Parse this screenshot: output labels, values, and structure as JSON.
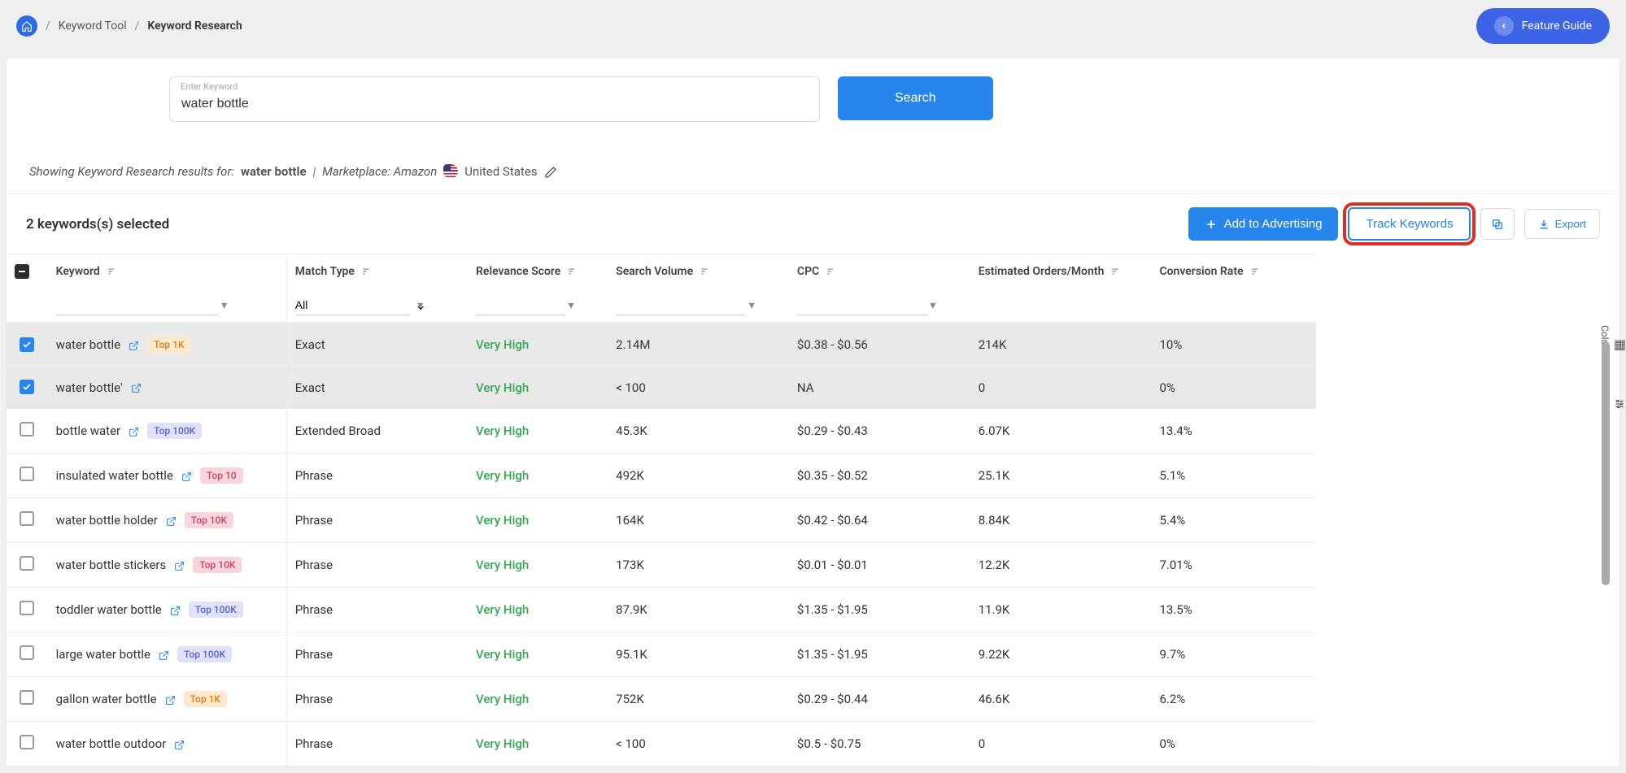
{
  "breadcrumb": {
    "root": "Keyword Tool",
    "current": "Keyword Research"
  },
  "feature_guide": "Feature Guide",
  "search": {
    "label": "Enter Keyword",
    "value": "water bottle",
    "button": "Search"
  },
  "results_info": {
    "prefix": "Showing Keyword Research results for:",
    "keyword": "water bottle",
    "marketplace_label": "Marketplace: Amazon",
    "country": "United States"
  },
  "selected_text": "2 keywords(s) selected",
  "actions": {
    "add_adv": "Add to Advertising",
    "track": "Track Keywords",
    "export": "Export"
  },
  "columns": {
    "keyword": "Keyword",
    "match_type": "Match Type",
    "relevance": "Relevance Score",
    "volume": "Search Volume",
    "cpc": "CPC",
    "orders": "Estimated Orders/Month",
    "conv": "Conversion Rate"
  },
  "filters": {
    "match_all": "All"
  },
  "badges": {
    "t1k": "Top 1K",
    "t100k": "Top 100K",
    "t10": "Top 10",
    "t10k": "Top 10K"
  },
  "rows": [
    {
      "checked": true,
      "keyword": "water bottle",
      "badge": "t1k",
      "match": "Exact",
      "relev": "Very High",
      "volume": "2.14M",
      "cpc": "$0.38 - $0.56",
      "orders": "214K",
      "conv": "10%"
    },
    {
      "checked": true,
      "keyword": "water bottle'",
      "badge": "",
      "match": "Exact",
      "relev": "Very High",
      "volume": "< 100",
      "cpc": "NA",
      "orders": "0",
      "conv": "0%"
    },
    {
      "checked": false,
      "keyword": "bottle water",
      "badge": "t100k",
      "match": "Extended Broad",
      "relev": "Very High",
      "volume": "45.3K",
      "cpc": "$0.29 - $0.43",
      "orders": "6.07K",
      "conv": "13.4%"
    },
    {
      "checked": false,
      "keyword": "insulated water bottle",
      "badge": "t10",
      "match": "Phrase",
      "relev": "Very High",
      "volume": "492K",
      "cpc": "$0.35 - $0.52",
      "orders": "25.1K",
      "conv": "5.1%"
    },
    {
      "checked": false,
      "keyword": "water bottle holder",
      "badge": "t10k",
      "match": "Phrase",
      "relev": "Very High",
      "volume": "164K",
      "cpc": "$0.42 - $0.64",
      "orders": "8.84K",
      "conv": "5.4%"
    },
    {
      "checked": false,
      "keyword": "water bottle stickers",
      "badge": "t10k",
      "match": "Phrase",
      "relev": "Very High",
      "volume": "173K",
      "cpc": "$0.01 - $0.01",
      "orders": "12.2K",
      "conv": "7.01%"
    },
    {
      "checked": false,
      "keyword": "toddler water bottle",
      "badge": "t100k",
      "match": "Phrase",
      "relev": "Very High",
      "volume": "87.9K",
      "cpc": "$1.35 - $1.95",
      "orders": "11.9K",
      "conv": "13.5%"
    },
    {
      "checked": false,
      "keyword": "large water bottle",
      "badge": "t100k",
      "match": "Phrase",
      "relev": "Very High",
      "volume": "95.1K",
      "cpc": "$1.35 - $1.95",
      "orders": "9.22K",
      "conv": "9.7%"
    },
    {
      "checked": false,
      "keyword": "gallon water bottle",
      "badge": "t1k",
      "match": "Phrase",
      "relev": "Very High",
      "volume": "752K",
      "cpc": "$0.29 - $0.44",
      "orders": "46.6K",
      "conv": "6.2%"
    },
    {
      "checked": false,
      "keyword": "water bottle outdoor",
      "badge": "",
      "match": "Phrase",
      "relev": "Very High",
      "volume": "< 100",
      "cpc": "$0.5 - $0.75",
      "orders": "0",
      "conv": "0%"
    }
  ],
  "side": {
    "columns": "Columns",
    "filters": "Filters"
  }
}
